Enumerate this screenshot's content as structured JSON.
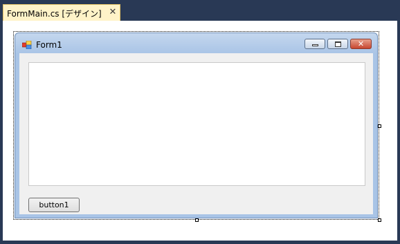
{
  "tab": {
    "title": "FormMain.cs [デザイン]",
    "close_glyph": "✕",
    "close_icon": "close-icon"
  },
  "form": {
    "title": "Form1",
    "icon": "form-app-icon",
    "caption_buttons": {
      "minimize": "minimize-icon",
      "maximize": "maximize-icon",
      "close": "close-icon",
      "close_glyph": "✕"
    },
    "button1_label": "button1"
  },
  "colors": {
    "ide_background": "#293955",
    "tab_active": "#fff3c8",
    "form_frame": "#a9c4e6",
    "client_area": "#f0f0f0"
  }
}
